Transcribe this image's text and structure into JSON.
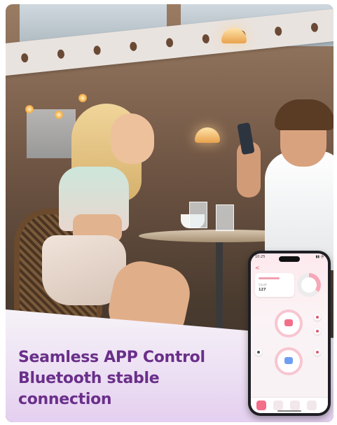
{
  "headline": {
    "line1": "Seamless APP Control",
    "line2": "Bluetooth stable",
    "line3": "connection"
  },
  "app_screen": {
    "status_time": "10:25",
    "status_icons": "▮▮ ◔",
    "back_symbol": "<",
    "stat_label": "Count",
    "stat_value": "127"
  },
  "colors": {
    "headline": "#6a2f8a",
    "accent_pink": "#f26f8a",
    "panel_lavender": "#e3cdef"
  }
}
